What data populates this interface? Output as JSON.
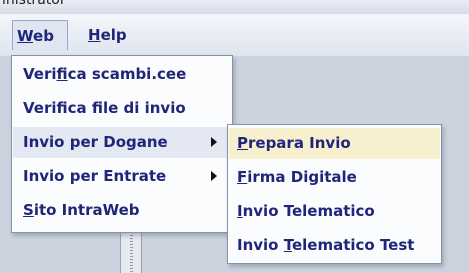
{
  "window": {
    "title_fragment": "inistrator"
  },
  "menubar": {
    "web": {
      "prefix": "",
      "mnemonic": "W",
      "rest": "eb"
    },
    "help": {
      "prefix": "",
      "mnemonic": "H",
      "rest": "elp"
    }
  },
  "web_menu": {
    "items": [
      {
        "prefix": "Veri",
        "mnemonic": "f",
        "rest": "ica scambi.cee"
      },
      {
        "prefix": "Verifica file di invio",
        "mnemonic": "",
        "rest": ""
      },
      {
        "prefix": "Invio per Dogane",
        "mnemonic": "",
        "rest": ""
      },
      {
        "prefix": "Invio per Entrate",
        "mnemonic": "",
        "rest": ""
      },
      {
        "prefix": "",
        "mnemonic": "S",
        "rest": "ito IntraWeb"
      }
    ]
  },
  "dogane_submenu": {
    "items": [
      {
        "prefix": "",
        "mnemonic": "P",
        "rest": "repara Invio"
      },
      {
        "prefix": "",
        "mnemonic": "F",
        "rest": "irma Digitale"
      },
      {
        "prefix": "",
        "mnemonic": "I",
        "rest": "nvio Telematico"
      },
      {
        "prefix": "Invio ",
        "mnemonic": "T",
        "rest": "elematico Test"
      }
    ]
  },
  "colors": {
    "menu_text": "#20257a",
    "highlight": "#e3e8f2",
    "submenu_highlight": "#f6f0cf",
    "background": "#ccd3df"
  },
  "icons": {
    "submenu_arrow": "right-triangle"
  }
}
